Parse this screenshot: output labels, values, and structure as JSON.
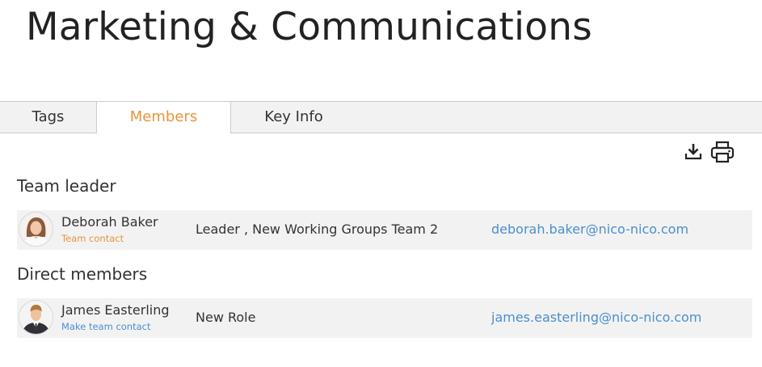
{
  "page": {
    "title": "Marketing & Communications"
  },
  "tabs": [
    {
      "label": "Tags",
      "active": false
    },
    {
      "label": "Members",
      "active": true
    },
    {
      "label": "Key Info",
      "active": false
    }
  ],
  "toolbar": {
    "download_icon": "download-icon",
    "print_icon": "printer-icon"
  },
  "colors": {
    "accent_orange": "#e8943a",
    "link_blue": "#4a90d0",
    "row_background": "#f2f2f2"
  },
  "sections": {
    "team_leader": {
      "heading": "Team leader",
      "members": [
        {
          "name": "Deborah Baker",
          "action": "Team contact",
          "role": "Leader , New Working Groups Team 2",
          "email": "deborah.baker@nico-nico.com"
        }
      ]
    },
    "direct_members": {
      "heading": "Direct members",
      "members": [
        {
          "name": "James Easterling",
          "action": "Make team contact",
          "role": "New Role",
          "email": "james.easterling@nico-nico.com"
        }
      ]
    }
  }
}
